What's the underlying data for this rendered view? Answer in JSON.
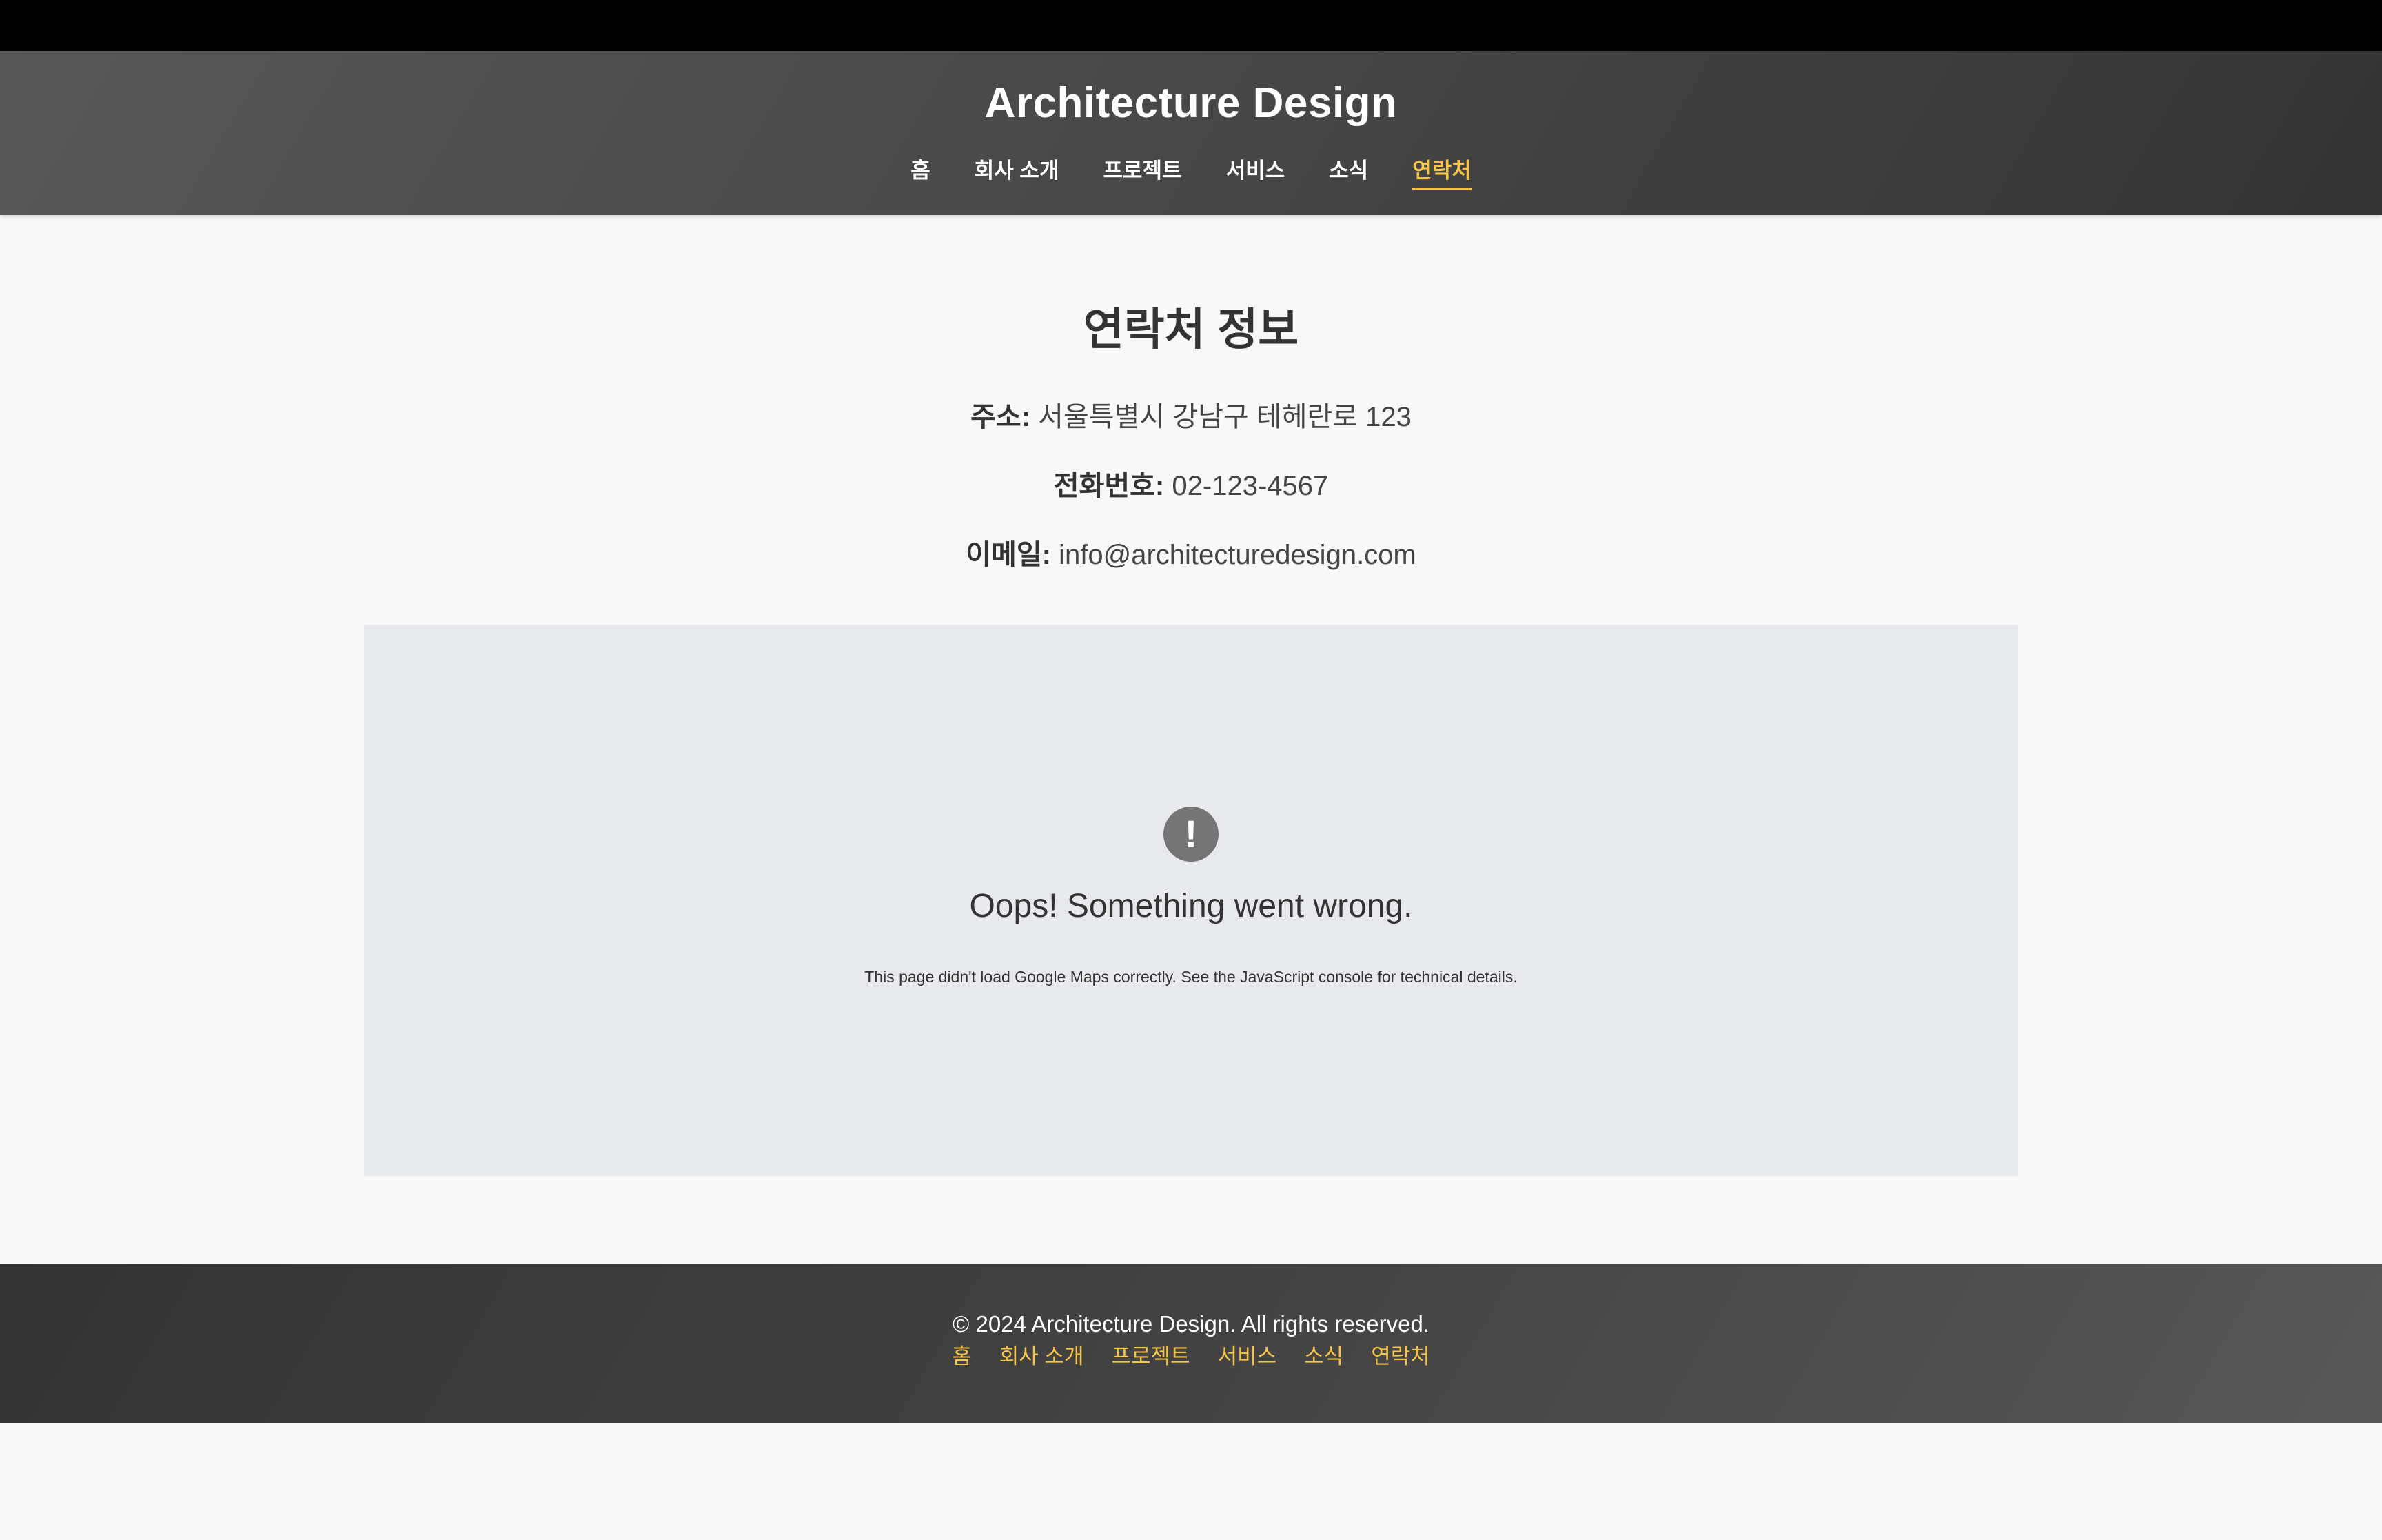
{
  "header": {
    "title": "Architecture Design",
    "nav": [
      {
        "label": "홈",
        "active": false
      },
      {
        "label": "회사 소개",
        "active": false
      },
      {
        "label": "프로젝트",
        "active": false
      },
      {
        "label": "서비스",
        "active": false
      },
      {
        "label": "소식",
        "active": false
      },
      {
        "label": "연락처",
        "active": true
      }
    ]
  },
  "contact": {
    "heading": "연락처 정보",
    "address_label": "주소:",
    "address_value": "서울특별시 강남구 테헤란로 123",
    "phone_label": "전화번호:",
    "phone_value": "02-123-4567",
    "email_label": "이메일:",
    "email_value": "info@architecturedesign.com"
  },
  "map": {
    "icon": "exclamation-icon",
    "icon_glyph": "!",
    "error_title": "Oops! Something went wrong.",
    "error_detail": "This page didn't load Google Maps correctly. See the JavaScript console for technical details."
  },
  "footer": {
    "copyright": "© 2024 Architecture Design. All rights reserved.",
    "links": [
      "홈",
      "회사 소개",
      "프로젝트",
      "서비스",
      "소식",
      "연락처"
    ]
  },
  "colors": {
    "accent": "#f5c44a",
    "header_dark": "#333333",
    "page_bg": "#f8f8f8",
    "map_bg": "#e8e9ec"
  }
}
